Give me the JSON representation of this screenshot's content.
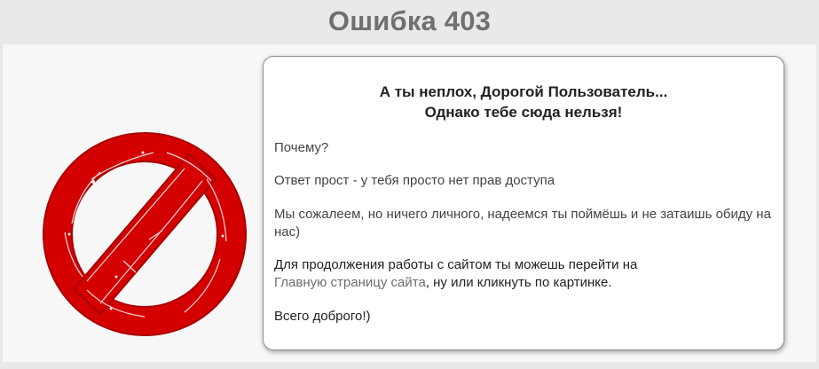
{
  "header": {
    "title": "Ошибка 403"
  },
  "icon": {
    "name": "prohibition-sign",
    "color": "#d40000"
  },
  "card": {
    "heading_line1": "А ты неплох, Дорогой Пользователь...",
    "heading_line2": "Однако тебе сюда нельзя!",
    "why": "Почему?",
    "answer": "Ответ прост - у тебя просто нет прав доступа",
    "sorry": "Мы сожалеем, но ничего личного, надеемся ты поймёшь и не затаишь обиду на нас)",
    "continue_before": "Для продолжения работы с сайтом ты можешь перейти на",
    "home_link": "Главную страницу сайта",
    "continue_after": ", ну или кликнуть по картинке.",
    "bye": "Всего доброго!)"
  }
}
